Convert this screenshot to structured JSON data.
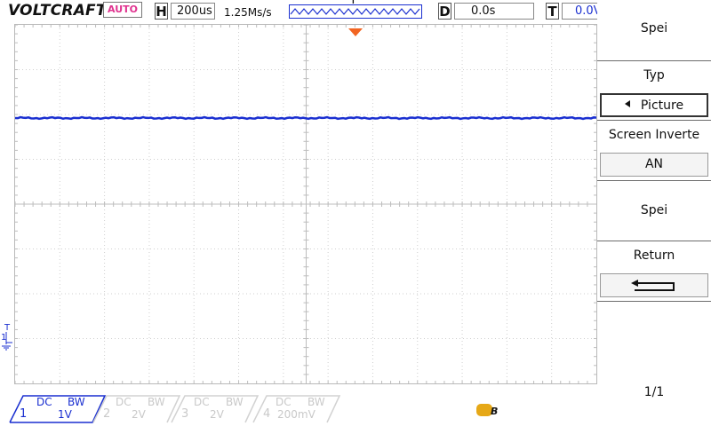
{
  "header": {
    "brand": "VOLTCRAFT.",
    "trigger_mode": "AUTO",
    "horizontal_tag": "H",
    "timebase": "200us",
    "sample_rate": "1.25Ms/s",
    "trigger_tag": "T",
    "delay_tag": "D",
    "delay_value": "0.0s",
    "trigger_level_tag": "T",
    "trigger_level_value": "0.0V"
  },
  "colors": {
    "ch1": "#1a2fd0",
    "trigger_marker": "#f26522",
    "auto_text": "#e0338f"
  },
  "screen": {
    "ch1_marker_label": "1",
    "ch1_trigger_label": "T"
  },
  "menu": {
    "title": "Spei",
    "sections": [
      {
        "label": "Typ",
        "value": "Picture",
        "has_left_arrow": true,
        "active": true
      },
      {
        "label": "Screen Inverte",
        "value": "AN"
      },
      {
        "label": "Spei"
      },
      {
        "label": "Return",
        "value_icon": "return-arrow-icon"
      }
    ],
    "page": "1/1"
  },
  "channels": [
    {
      "num": "1",
      "coupling": "DC",
      "bw": "BW",
      "volts": "1V",
      "active": true
    },
    {
      "num": "2",
      "coupling": "DC",
      "bw": "BW",
      "volts": "2V",
      "active": false
    },
    {
      "num": "3",
      "coupling": "DC",
      "bw": "BW",
      "volts": "2V",
      "active": false
    },
    {
      "num": "4",
      "coupling": "DC",
      "bw": "BW",
      "volts": "200mV",
      "active": false
    }
  ],
  "status_icon": "run-status-icon"
}
